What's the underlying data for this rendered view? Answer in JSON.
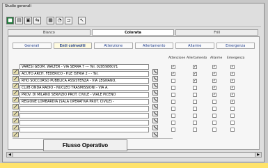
{
  "window": {
    "title": "Studio generali"
  },
  "toolbar": {
    "buttons": [
      "green-block-icon",
      "document-icon",
      "floppy-disk-icon",
      "shield-arrow-icon",
      "grid-icon",
      "pie-icon",
      "tools-icon",
      "pointer-icon"
    ]
  },
  "main_tabs": [
    {
      "label": "Bianco"
    },
    {
      "label": "Colorata",
      "active": true
    },
    {
      "label": "Frill"
    }
  ],
  "sub_tabs": [
    {
      "label": "Generali"
    },
    {
      "label": "Enti coinvolti",
      "active": true
    },
    {
      "label": "Attenzione"
    },
    {
      "label": "Allertamento"
    },
    {
      "label": "Allarme"
    },
    {
      "label": "Emergenza"
    }
  ],
  "columns": [
    "Attenzione",
    "Allertamento",
    "Allarme",
    "Emergenza"
  ],
  "rows": [
    {
      "text": "VARESI GEOM. WALTER - VIA SERRA 7 --- Tel. 0285986071",
      "checks": [
        true,
        true,
        true,
        true
      ]
    },
    {
      "text": "ACUTO ARCH. FEDERICO - P.LE ISTRIA 2 - - Tel.",
      "checks": [
        true,
        true,
        true,
        true
      ]
    },
    {
      "text": "RHO SOCCORSO PUBBLICA ASSISTENZA - VIA LEGNANO,",
      "checks": [
        false,
        true,
        true,
        true
      ]
    },
    {
      "text": "CLUB ONDA RADIO - NUCLEO TRASMISSIONI - VIA A.",
      "checks": [
        false,
        false,
        true,
        true
      ]
    },
    {
      "text": "PROV. DI MILANO SERVIZIO PROT. CIVILE - VIALE PICENO",
      "checks": [
        false,
        false,
        true,
        true
      ]
    },
    {
      "text": "REGIONE LOMBARDIA (SALA OPERATIVA PROT. CIVILE) -",
      "checks": [
        false,
        false,
        false,
        true
      ]
    },
    {
      "text": "",
      "checks": [
        false,
        false,
        false,
        false
      ]
    },
    {
      "text": "",
      "checks": [
        false,
        false,
        false,
        false
      ]
    },
    {
      "text": "",
      "checks": [
        false,
        false,
        false,
        false
      ]
    },
    {
      "text": "",
      "checks": [
        false,
        false,
        false,
        false
      ]
    }
  ],
  "flusso_button": "Flusso Operativo",
  "colors": {
    "accent_yellow": "#ffe36b",
    "tab_text_blue": "#1c3c8c",
    "toolbar_green": "#1f7a3a"
  }
}
